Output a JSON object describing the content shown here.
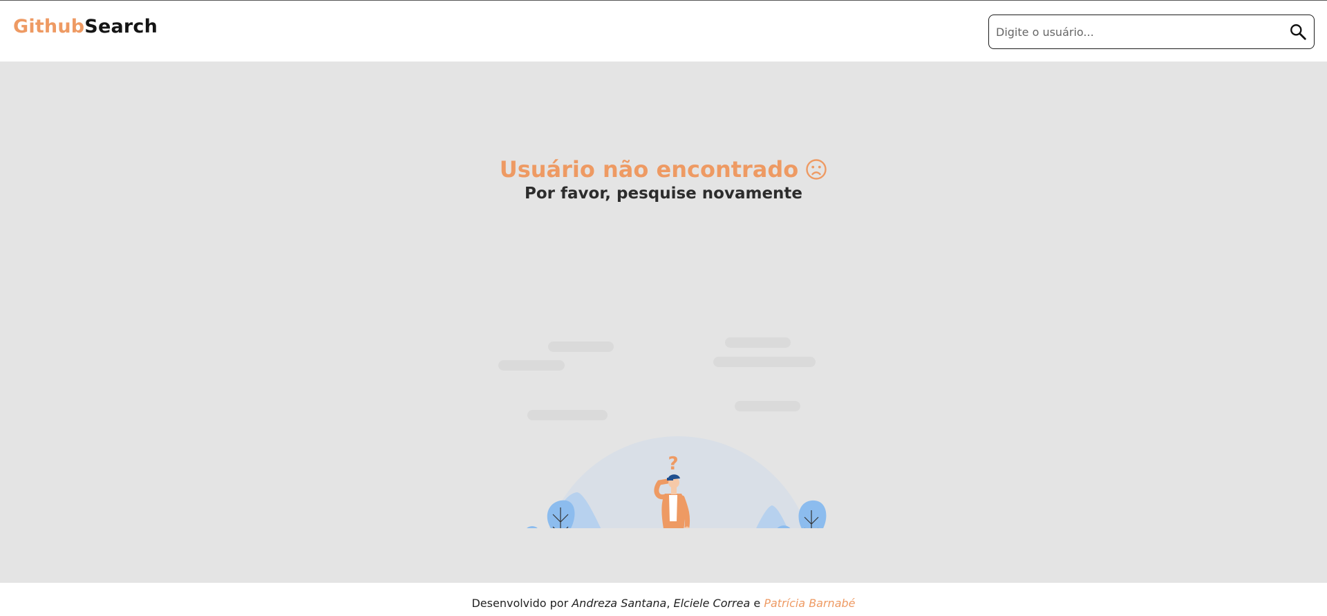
{
  "colors": {
    "accent": "#ee9a63",
    "background": "#e4e4e4",
    "tree_blue": "#8cbcee"
  },
  "header": {
    "logo_part1": "Github",
    "logo_part2": "Search",
    "search": {
      "placeholder": "Digite o usuário...",
      "value": "",
      "icon": "search-icon"
    }
  },
  "main": {
    "title": "Usuário não encontrado",
    "title_icon": "sad-face-icon",
    "subtitle": "Por favor, pesquise novamente",
    "illustration": "confused-person-illustration",
    "illustration_mark": "?"
  },
  "footer": {
    "prefix": "Desenvolvido por",
    "author1": "Andreza Santana",
    "separator": ",",
    "author2": "Elciele Correa",
    "conjunction": "e",
    "author3": "Patrícia Barnabé"
  }
}
